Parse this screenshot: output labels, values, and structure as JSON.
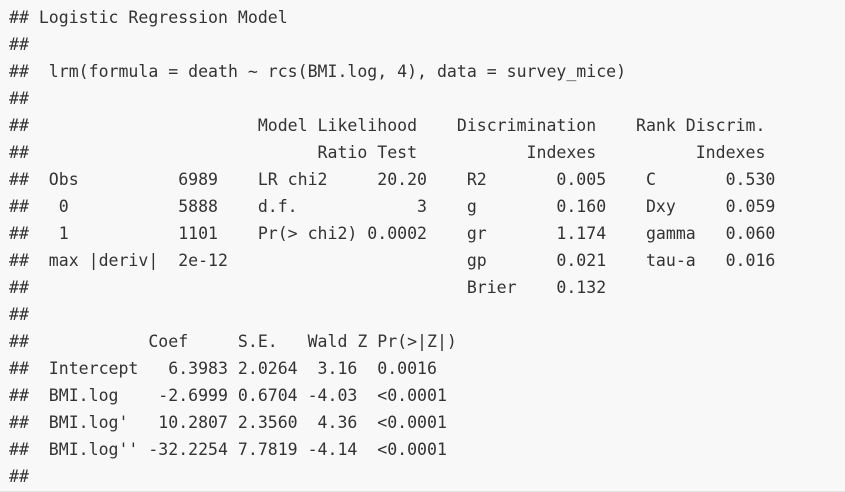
{
  "output": {
    "lines": [
      "## Logistic Regression Model",
      "##",
      "##  lrm(formula = death ~ rcs(BMI.log, 4), data = survey_mice)",
      "##",
      "##                       Model Likelihood    Discrimination    Rank Discrim.",
      "##                             Ratio Test           Indexes          Indexes",
      "##  Obs          6989    LR chi2     20.20    R2       0.005    C       0.530",
      "##   0           5888    d.f.            3    g        0.160    Dxy     0.059",
      "##   1           1101    Pr(> chi2) 0.0002    gr       1.174    gamma   0.060",
      "##  max |deriv|  2e-12                        gp       0.021    tau-a   0.016",
      "##                                            Brier    0.132",
      "##",
      "##            Coef     S.E.   Wald Z Pr(>|Z|)",
      "##  Intercept   6.3983 2.0264  3.16  0.0016",
      "##  BMI.log    -2.6999 0.6704 -4.03  <0.0001",
      "##  BMI.log'   10.2807 2.3560  4.36  <0.0001",
      "##  BMI.log'' -32.2254 7.7819 -4.14  <0.0001",
      "##"
    ]
  }
}
